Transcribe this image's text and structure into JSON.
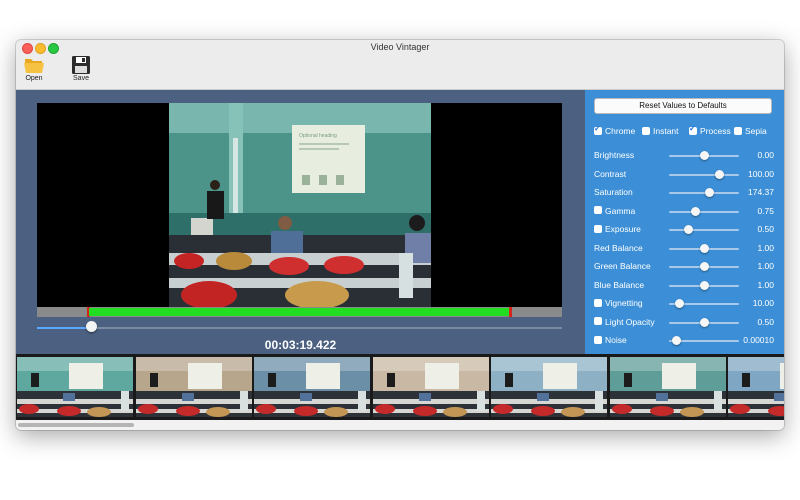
{
  "window": {
    "title": "Video Vintager"
  },
  "toolbar": {
    "open_label": "Open",
    "save_label": "Save"
  },
  "player": {
    "timecode": "00:03:19.422",
    "scrub_fraction": 0.103
  },
  "slide": {
    "heading": "Optional heading"
  },
  "panel": {
    "reset_label": "Reset Values to Defaults",
    "presets": [
      {
        "label": "Chrome",
        "checked": true
      },
      {
        "label": "Instant",
        "checked": false
      },
      {
        "label": "Process",
        "checked": true
      },
      {
        "label": "Sepia",
        "checked": false
      }
    ],
    "params": [
      {
        "label": "Brightness",
        "value": "0.00",
        "checkbox": false,
        "slider_fraction": 0.5
      },
      {
        "label": "Contrast",
        "value": "100.00",
        "checkbox": false,
        "slider_fraction": 0.72
      },
      {
        "label": "Saturation",
        "value": "174.37",
        "checkbox": false,
        "slider_fraction": 0.58
      },
      {
        "label": "Gamma",
        "value": "0.75",
        "checkbox": true,
        "slider_fraction": 0.38
      },
      {
        "label": "Exposure",
        "value": "0.50",
        "checkbox": true,
        "slider_fraction": 0.28
      },
      {
        "label": "Red Balance",
        "value": "1.00",
        "checkbox": false,
        "slider_fraction": 0.5
      },
      {
        "label": "Green Balance",
        "value": "1.00",
        "checkbox": false,
        "slider_fraction": 0.5
      },
      {
        "label": "Blue Balance",
        "value": "1.00",
        "checkbox": false,
        "slider_fraction": 0.5
      },
      {
        "label": "Vignetting",
        "value": "10.00",
        "checkbox": true,
        "slider_fraction": 0.15
      },
      {
        "label": "Light Opacity",
        "value": "0.50",
        "checkbox": true,
        "slider_fraction": 0.5
      },
      {
        "label": "Noise",
        "value": "0.00010",
        "checkbox": true,
        "slider_fraction": 0.1
      }
    ]
  },
  "filmstrip": {
    "thumbnails": [
      {
        "tint": "#5fa8a0"
      },
      {
        "tint": "#b7a58c"
      },
      {
        "tint": "#6c8fa8"
      },
      {
        "tint": "#c9b9a4"
      },
      {
        "tint": "#8db0c4"
      },
      {
        "tint": "#5f9e98"
      },
      {
        "tint": "#7fa6c2"
      }
    ]
  },
  "colors": {
    "video_bg": "#4c6182",
    "panel_bg": "#3c8fd6",
    "timeline_green": "#22dd22",
    "timeline_marker": "#d4241a",
    "scrub_fill": "#5aa8ff"
  }
}
